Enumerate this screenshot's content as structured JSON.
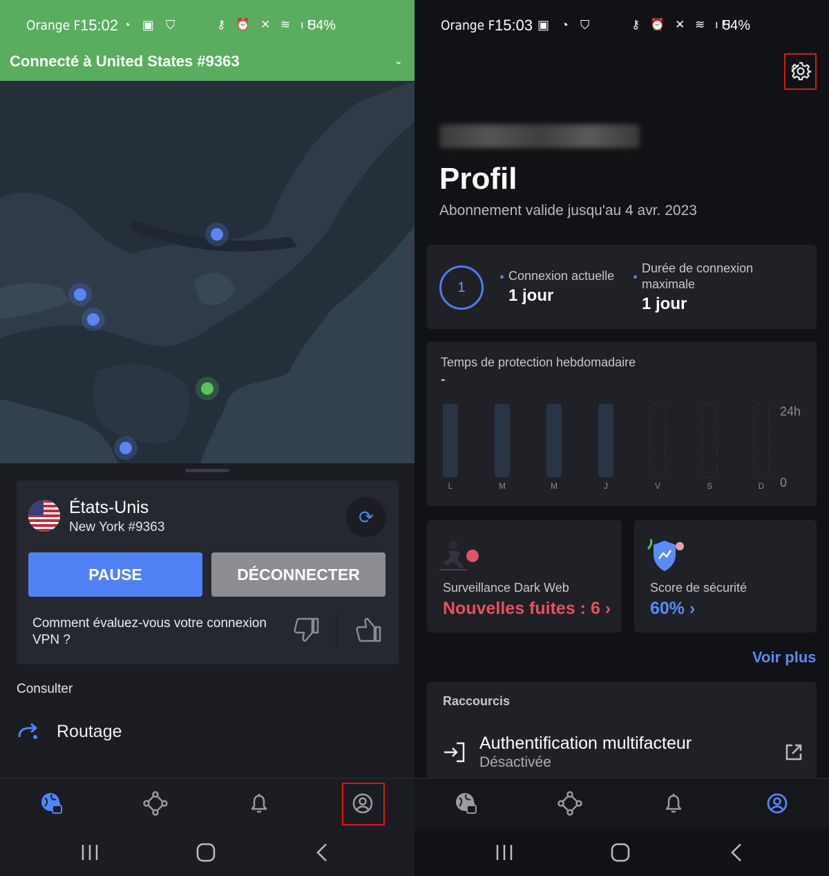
{
  "left": {
    "status": {
      "carrier": "Orange F",
      "time": "15:02",
      "left_icons": "◔ ▣ ⛉",
      "right_icons": "⚷ ⏰ ✕ ≋ ıll",
      "battery": "54%"
    },
    "banner": "Connecté à United States #9363",
    "colors": {
      "banner": "#5aad5f",
      "accent": "#5082f6"
    },
    "server": {
      "country": "États-Unis",
      "city": "New York #9363"
    },
    "buttons": {
      "pause": "PAUSE",
      "disconnect": "DÉCONNECTER"
    },
    "rating_question": "Comment évaluez-vous votre connexion VPN ?",
    "consult_label": "Consulter",
    "routing_label": "Routage",
    "nav_active": "globe"
  },
  "right": {
    "status": {
      "carrier": "Orange F",
      "time": "15:03",
      "left_icons": "▣ ◔ ⛉",
      "right_icons": "⚷ ⏰ ✕ ≋ ıll",
      "battery": "54%"
    },
    "title": "Profil",
    "subscription": "Abonnement valide jusqu'au 4 avr. 2023",
    "ring_value": "1",
    "current_label": "Connexion actuelle",
    "current_value": "1 jour",
    "max_label_1": "Durée de connexion",
    "max_label_2": "maximale",
    "max_value": "1 jour",
    "dark_web_label": "Surveillance Dark Web",
    "dark_web_value": "Nouvelles fuites : 6",
    "security_label": "Score de sécurité",
    "security_value": "60%",
    "see_more": "Voir plus",
    "shortcuts_title": "Raccourcis",
    "mfa_title": "Authentification multifacteur",
    "mfa_status": "Désactivée",
    "nav_active": "profile"
  },
  "chart_data": {
    "type": "bar",
    "title": "Temps de protection hebdomadaire",
    "subtitle": "-",
    "categories": [
      "L",
      "M",
      "M",
      "J",
      "V",
      "S",
      "D"
    ],
    "values": [
      24,
      24,
      24,
      24,
      0,
      0,
      0
    ],
    "ylim": [
      0,
      24
    ],
    "yticks": [
      "24h",
      "0"
    ],
    "bar_style": [
      "filled",
      "filled",
      "filled",
      "filled",
      "dashed",
      "dashed",
      "dashed"
    ],
    "bar_color": "#2a3447"
  }
}
